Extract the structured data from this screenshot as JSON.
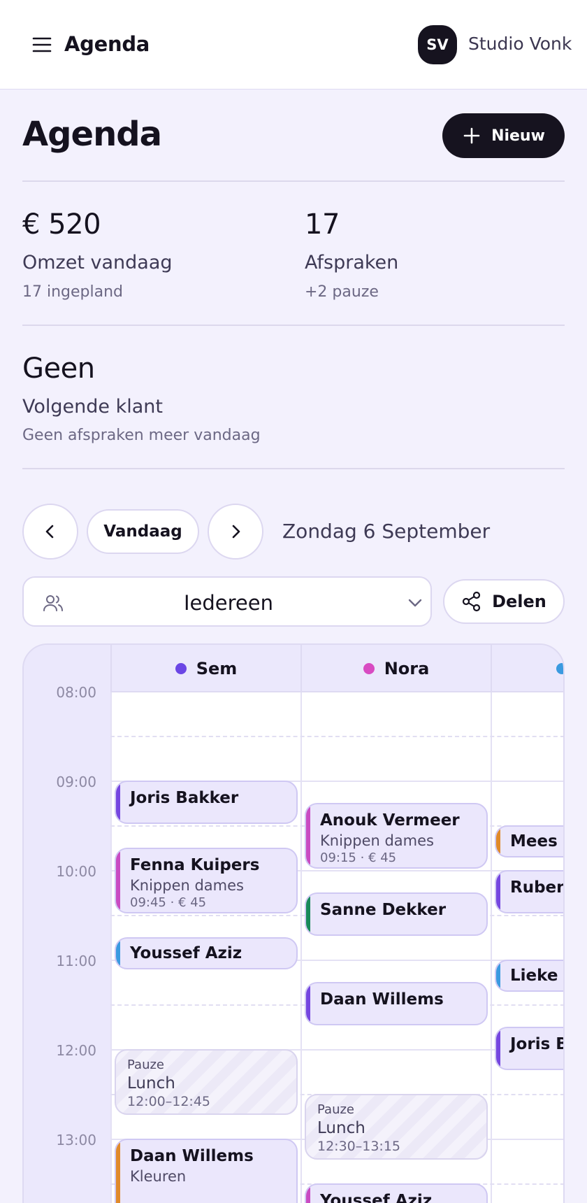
{
  "header": {
    "app_title": "Agenda",
    "avatar_initials": "SV",
    "studio_name": "Studio Vonk",
    "menu_icon": "menu-icon"
  },
  "page": {
    "title": "Agenda",
    "new_button_label": "Nieuw"
  },
  "stats": {
    "revenue": {
      "value": "€ 520",
      "label": "Omzet vandaag",
      "sub": "17 ingepland"
    },
    "appointments": {
      "value": "17",
      "label": "Afspraken",
      "sub": "+2 pauze"
    },
    "next_client": {
      "value": "Geen",
      "label": "Volgende klant",
      "sub": "Geen afspraken meer vandaag"
    }
  },
  "nav": {
    "prev_icon": "chevron-left-icon",
    "today_label": "Vandaag",
    "next_icon": "chevron-right-icon",
    "date_label": "Zondag 6 September"
  },
  "filter": {
    "staff_value": "Iedereen",
    "share_label": "Delen"
  },
  "calendar": {
    "hours": [
      "08:00",
      "09:00",
      "10:00",
      "11:00",
      "12:00",
      "13:00"
    ],
    "columns": [
      {
        "name": "Sem",
        "color": "#6b46e5"
      },
      {
        "name": "Nora",
        "color": "#d84bc2"
      },
      {
        "name": "",
        "color": "#3a9ae0"
      }
    ],
    "appointments": {
      "sem": [
        {
          "name": "Joris Bakker",
          "color": "#7546e0"
        },
        {
          "name": "Fenna Kuipers",
          "service": "Knippen dames",
          "meta": "09:45 · € 45",
          "color": "#c94bc2"
        },
        {
          "name": "Youssef Aziz",
          "color": "#3a9ae0"
        },
        {
          "pause_kind": "Pauze",
          "pause_label": "Lunch",
          "pause_time": "12:00–12:45"
        },
        {
          "name": "Daan Willems",
          "service": "Kleuren",
          "color": "#e08a2a"
        }
      ],
      "nora": [
        {
          "name": "Anouk Vermeer",
          "service": "Knippen dames",
          "meta": "09:15 · € 45",
          "color": "#c94bc2"
        },
        {
          "name": "Sanne Dekker",
          "color": "#198a5a"
        },
        {
          "name": "Daan Willems",
          "color": "#7546e0"
        },
        {
          "pause_kind": "Pauze",
          "pause_label": "Lunch",
          "pause_time": "12:30–13:15"
        },
        {
          "name": "Youssef Aziz",
          "color": "#c94bc2"
        }
      ],
      "third": [
        {
          "name": "Mees v",
          "color": "#e08a2a"
        },
        {
          "name": "Ruben",
          "color": "#7546e0"
        },
        {
          "name": "Lieke P",
          "color": "#3a9ae0"
        },
        {
          "name": "Joris Ba",
          "color": "#7546e0"
        }
      ]
    }
  }
}
